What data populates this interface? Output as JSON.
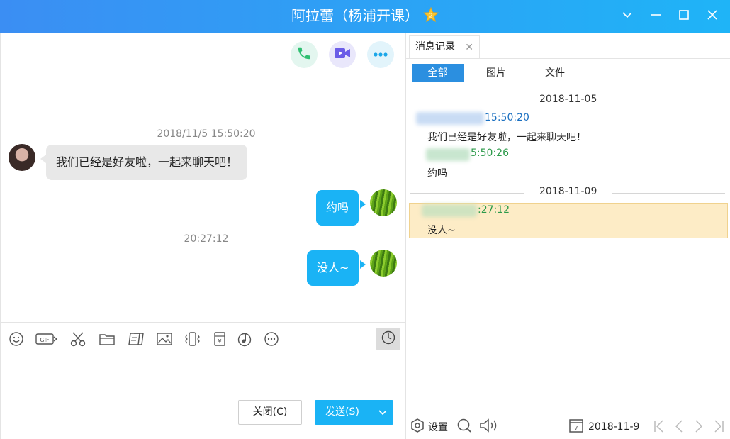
{
  "window": {
    "title": "阿拉蕾（杨浦开课）",
    "badge_icon": "star-badge-icon"
  },
  "chat": {
    "messages": [
      {
        "timestamp": "2018/11/5 15:50:20",
        "direction": "incoming",
        "text": "我们已经是好友啦，一起来聊天吧！"
      },
      {
        "direction": "outgoing",
        "text": "约吗"
      },
      {
        "timestamp": "20:27:12",
        "direction": "outgoing",
        "text": "没人~"
      }
    ],
    "toolbar_icons": [
      "emoji-icon",
      "gif-icon",
      "scissors-icon",
      "folder-icon",
      "doc-icon",
      "image-icon",
      "shake-icon",
      "red-packet-icon",
      "music-icon",
      "more-icon"
    ],
    "close_label": "关闭(C)",
    "send_label": "发送(S)"
  },
  "history": {
    "tab_label": "消息记录",
    "filters": [
      "全部",
      "图片",
      "文件"
    ],
    "groups": [
      {
        "date": "2018-11-05",
        "entries": [
          {
            "time": "15:50:20",
            "text": "我们已经是好友啦，一起来聊天吧！",
            "color": "#1a6fc0"
          },
          {
            "time": "5:50:26",
            "text": "约吗",
            "color": "#2c9a4a"
          }
        ]
      },
      {
        "date": "2018-11-09",
        "entries": [
          {
            "time": ":27:12",
            "text": "没人~",
            "color": "#2c9a4a"
          }
        ]
      }
    ],
    "settings_label": "设置",
    "date_value": "2018-11-9"
  }
}
